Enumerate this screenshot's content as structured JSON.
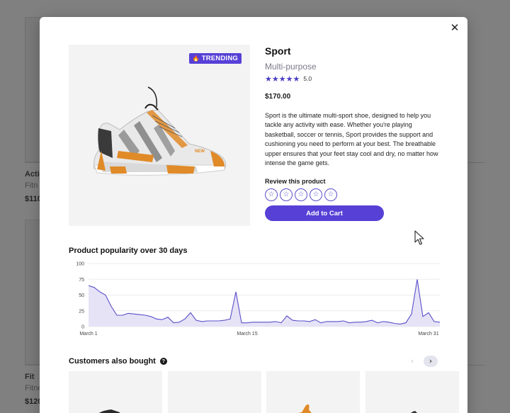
{
  "background": {
    "cards": [
      {
        "name": "Acti",
        "category": "Fitn",
        "price": "$110"
      },
      {
        "name": "Fit",
        "category": "Fitne",
        "price": "$120"
      }
    ]
  },
  "modal": {
    "close_icon": "close-icon",
    "badge": {
      "icon": "fire-icon",
      "label": "TRENDING"
    },
    "product": {
      "name": "Sport",
      "category": "Multi-purpose",
      "stars": "★★★★★",
      "rating": "5.0",
      "price": "$170.00",
      "description": "Sport is the ultimate multi-sport shoe, designed to help you tackle any activity with ease. Whether you're playing basketball, soccer or tennis, Sport provides the support and cushioning you need to perform at your best. The breathable upper ensures that your feet stay cool and dry, no matter how intense the game gets."
    },
    "review": {
      "label": "Review this product",
      "star_glyph": "☆",
      "count": 5
    },
    "add_to_cart_label": "Add to Cart",
    "accent_color": "#5640d6"
  },
  "chart_data": {
    "type": "area",
    "title": "Product popularity over 30 days",
    "xlabel": "",
    "ylabel": "",
    "ylim": [
      0,
      100
    ],
    "yticks": [
      0,
      25,
      50,
      75,
      100
    ],
    "xticks": [
      "March 1",
      "March 15",
      "March 31"
    ],
    "x_tick_days": [
      1,
      15,
      31
    ],
    "x_days": [
      1,
      1.5,
      2,
      2.5,
      3,
      3.5,
      4,
      4.5,
      5,
      5.5,
      6,
      6.5,
      7,
      7.5,
      8,
      8.5,
      9,
      9.5,
      10,
      10.5,
      11,
      11.5,
      12,
      12.5,
      13,
      13.5,
      14,
      14.5,
      15,
      15.5,
      16,
      16.5,
      17,
      17.5,
      18,
      18.5,
      19,
      19.5,
      20,
      20.5,
      21,
      21.5,
      22,
      22.5,
      23,
      23.5,
      24,
      24.5,
      25,
      25.5,
      26,
      26.5,
      27,
      27.5,
      28,
      28.5,
      29,
      29.5,
      30,
      30.5,
      31,
      31.5,
      32
    ],
    "values": [
      65,
      62,
      55,
      50,
      32,
      18,
      18,
      21,
      20,
      19,
      18,
      16,
      12,
      11,
      15,
      6,
      7,
      12,
      22,
      10,
      8,
      9,
      9,
      9,
      10,
      12,
      55,
      6,
      6,
      7,
      7,
      7,
      7,
      8,
      6,
      17,
      10,
      9,
      9,
      8,
      11,
      6,
      8,
      8,
      8,
      9,
      6,
      7,
      7,
      8,
      10,
      6,
      8,
      7,
      5,
      4,
      6,
      20,
      75,
      16,
      22,
      8,
      7
    ],
    "series_color": "#5a4fc8",
    "fill_color": "#e6e3f7",
    "grid": true
  },
  "also_bought": {
    "title": "Customers also bought",
    "help_icon": "help-icon",
    "prev_icon": "chevron-left-icon",
    "next_icon": "chevron-right-icon",
    "prev_glyph": "‹",
    "next_glyph": "›"
  }
}
